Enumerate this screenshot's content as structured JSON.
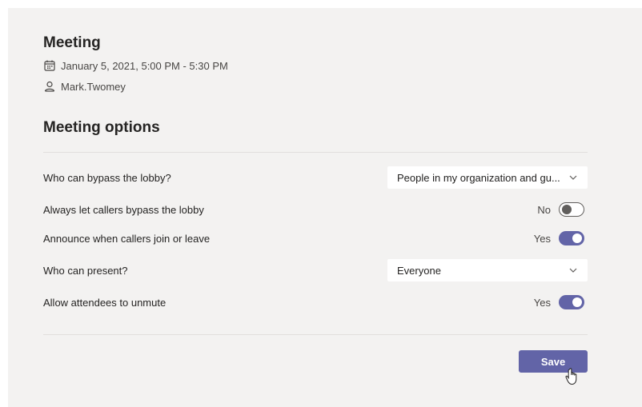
{
  "meeting": {
    "title": "Meeting",
    "date_time": "January 5, 2021, 5:00 PM - 5:30 PM",
    "organizer": "Mark.Twomey"
  },
  "options": {
    "title": "Meeting options",
    "bypass_lobby": {
      "label": "Who can bypass the lobby?",
      "value": "People in my organization and gu..."
    },
    "callers_bypass": {
      "label": "Always let callers bypass the lobby",
      "state": "No"
    },
    "announce": {
      "label": "Announce when callers join or leave",
      "state": "Yes"
    },
    "presenters": {
      "label": "Who can present?",
      "value": "Everyone"
    },
    "unmute": {
      "label": "Allow attendees to unmute",
      "state": "Yes"
    }
  },
  "save_label": "Save",
  "colors": {
    "accent": "#6264a7",
    "panel": "#f3f2f1"
  }
}
